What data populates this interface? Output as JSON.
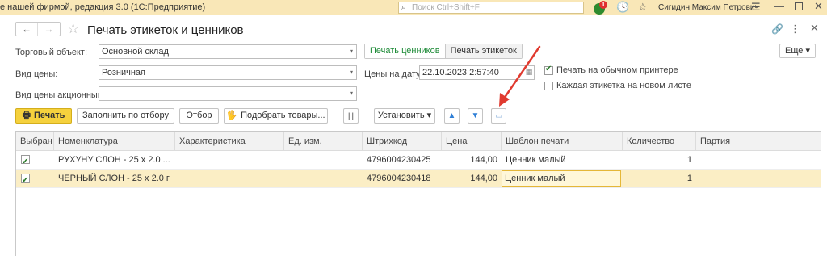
{
  "appbar": {
    "title": "е нашей фирмой, редакция 3.0  (1С:Предприятие)",
    "search_placeholder": "Поиск Ctrl+Shift+F",
    "notification_count": "1",
    "user": "Сигидин Максим Петрович"
  },
  "form": {
    "title": "Печать этикеток и ценников"
  },
  "fields": {
    "trade_object": {
      "label": "Торговый объект:",
      "value": "Основной склад"
    },
    "price_kind": {
      "label": "Вид цены:",
      "value": "Розничная"
    },
    "promo_price_kind": {
      "label": "Вид цены акционный:",
      "value": ""
    },
    "price_date": {
      "label": "Цены на дату:",
      "value": "22.10.2023  2:57:40"
    }
  },
  "toggle": {
    "price_tags": "Печать ценников",
    "labels": "Печать этикеток"
  },
  "options": {
    "regular_printer": {
      "label": "Печать на обычном принтере",
      "checked": true
    },
    "each_label_new_sheet": {
      "label": "Каждая этикетка на новом листе",
      "checked": false
    }
  },
  "more_button": "Еще",
  "toolbar": {
    "print": "Печать",
    "fill_by_selection": "Заполнить по отбору",
    "filter": "Отбор",
    "pick_goods": "Подобрать товары...",
    "set": "Установить"
  },
  "table": {
    "columns": [
      "Выбран",
      "Номенклатура",
      "Характеристика",
      "Ед. изм.",
      "Штрихкод",
      "Цена",
      "Шаблон печати",
      "Количество",
      "Партия"
    ],
    "rows": [
      {
        "selected": true,
        "item": "РУХУНУ  СЛОН - 25 х 2.0 ...",
        "characteristic": "",
        "unit": "",
        "barcode": "4796004230425",
        "price": "144,00",
        "template": "Ценник малый",
        "qty": "1",
        "batch": ""
      },
      {
        "selected": true,
        "item": "ЧЕРНЫЙ  СЛОН - 25 х 2.0 г",
        "characteristic": "",
        "unit": "",
        "barcode": "4796004230418",
        "price": "144,00",
        "template": "Ценник малый",
        "qty": "1",
        "batch": ""
      }
    ]
  },
  "colors": {
    "appbar": "#f9e7b7",
    "primary_button": "#f5d13d",
    "selected_row": "#fbeec5",
    "annotation_arrow": "#e03a2f",
    "active_toggle_text": "#1c8a36"
  }
}
